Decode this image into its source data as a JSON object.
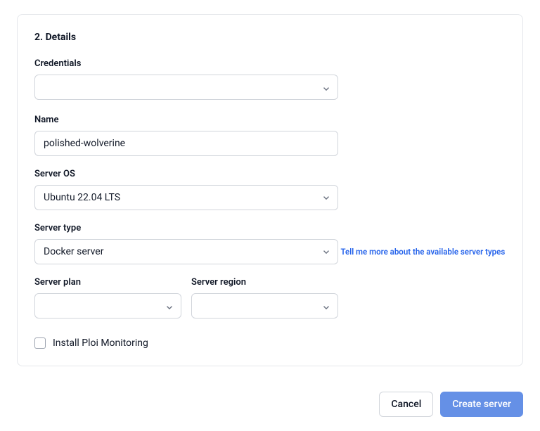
{
  "section": {
    "title": "2. Details"
  },
  "fields": {
    "credentials": {
      "label": "Credentials",
      "value": ""
    },
    "name": {
      "label": "Name",
      "value": "polished-wolverine"
    },
    "server_os": {
      "label": "Server OS",
      "value": "Ubuntu 22.04 LTS"
    },
    "server_type": {
      "label": "Server type",
      "value": "Docker server",
      "help_link": "Tell me more about the available server types"
    },
    "server_plan": {
      "label": "Server plan",
      "value": ""
    },
    "server_region": {
      "label": "Server region",
      "value": ""
    },
    "install_monitoring": {
      "label": "Install Ploi Monitoring",
      "checked": false
    }
  },
  "actions": {
    "cancel": "Cancel",
    "create": "Create server"
  }
}
